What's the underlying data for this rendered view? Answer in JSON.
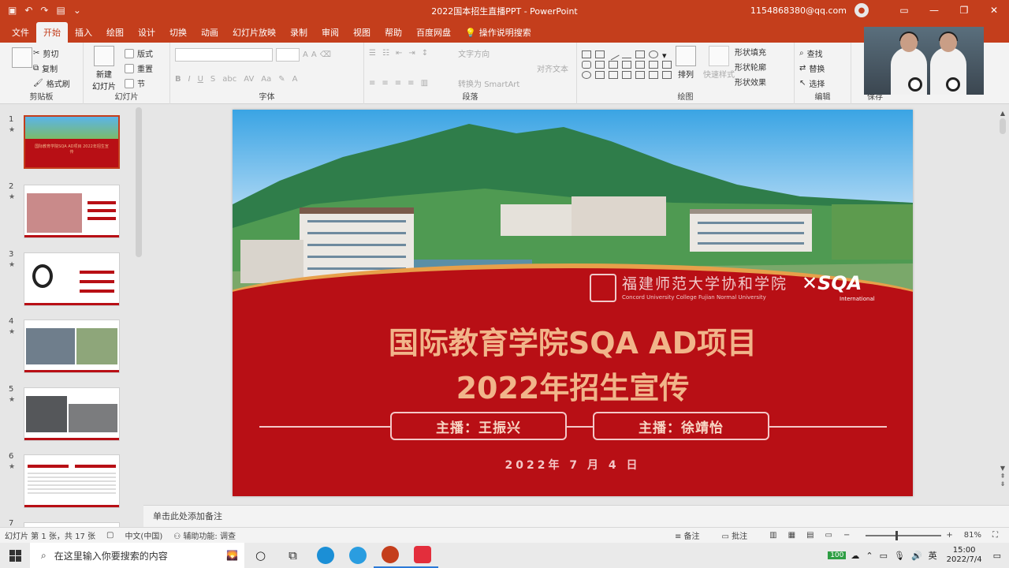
{
  "window": {
    "title": "2022国本招生直播PPT  -  PowerPoint",
    "account": "1154868380@qq.com"
  },
  "tabs": [
    "文件",
    "开始",
    "插入",
    "绘图",
    "设计",
    "切换",
    "动画",
    "幻灯片放映",
    "录制",
    "审阅",
    "视图",
    "帮助",
    "百度网盘",
    "操作说明搜索"
  ],
  "ribbon": {
    "clipboard": {
      "cut": "剪切",
      "copy": "复制",
      "format_painter": "格式刷",
      "label": "剪贴板"
    },
    "slides": {
      "new_slide": "新建",
      "new_slide_2": "幻灯片",
      "layout": "版式",
      "reset": "重置",
      "section": "节",
      "label": "幻灯片"
    },
    "font": {
      "label": "字体"
    },
    "paragraph": {
      "text_direction": "文字方向",
      "align_text": "对齐文本",
      "smartart": "转换为 SmartArt",
      "label": "段落"
    },
    "drawing": {
      "arrange": "排列",
      "quick_styles": "快速样式",
      "shape_fill": "形状填充",
      "shape_outline": "形状轮廓",
      "shape_effects": "形状效果",
      "label": "绘图"
    },
    "editing": {
      "find": "查找",
      "replace": "替换",
      "select": "选择",
      "label": "编辑"
    },
    "save": {
      "label": "保存"
    }
  },
  "thumbnails": [
    {
      "num": "1",
      "star": "★",
      "title": "国际教育学院SQA AD项目 2022年招生宣传"
    },
    {
      "num": "2",
      "star": "★"
    },
    {
      "num": "3",
      "star": "★"
    },
    {
      "num": "4",
      "star": "★"
    },
    {
      "num": "5",
      "star": "★"
    },
    {
      "num": "6",
      "star": "★"
    },
    {
      "num": "7",
      "star": "★"
    }
  ],
  "slide": {
    "school_name_cn": "福建师范大学协和学院",
    "school_name_en": "Concord University College Fujian Normal University",
    "sqa_logo": "SQA",
    "sqa_sub": "International",
    "title_line1": "国际教育学院SQA AD项目",
    "title_line2": "2022年招生宣传",
    "host1": "主播：王振兴",
    "host2": "主播：徐靖怡",
    "date": "2022年 7 月 4 日"
  },
  "notes": {
    "placeholder": "单击此处添加备注"
  },
  "status": {
    "slide_info": "幻灯片 第 1 张，共 17 张",
    "language": "中文(中国)",
    "accessibility": "辅助功能: 调查",
    "notes_btn": "备注",
    "comments_btn": "批注",
    "zoom": "81%",
    "zoom_level": 0.81
  },
  "taskbar": {
    "search_placeholder": "在这里输入你要搜索的内容",
    "time": "15:00",
    "date": "2022/7/4",
    "battery": "100"
  },
  "colors": {
    "brand": "#c43e1c",
    "slide_red": "#b80f15",
    "title_gold": "#f1b58a"
  }
}
